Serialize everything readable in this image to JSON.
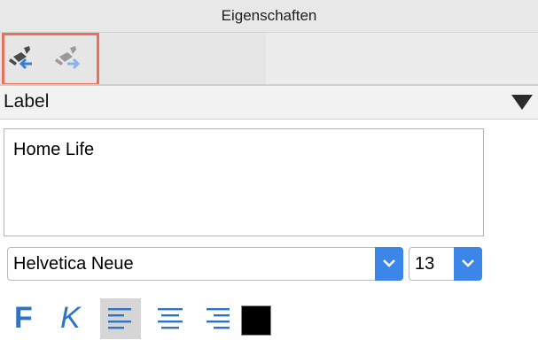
{
  "window": {
    "title": "Eigenschaften"
  },
  "toolbar": {
    "buttons": [
      {
        "name": "paste-style-button",
        "icon": "brush-arrow-left-icon"
      },
      {
        "name": "copy-style-button",
        "icon": "brush-arrow-right-icon"
      }
    ]
  },
  "label_section": {
    "title": "Label",
    "text": "Home Life",
    "font": {
      "family": "Helvetica Neue",
      "size": "13"
    },
    "format": {
      "bold": "F",
      "italic": "K",
      "alignment": "left",
      "color": "#000000"
    }
  },
  "colors": {
    "accent": "#3d86e9",
    "highlight_border": "#e8715b",
    "format_blue": "#2f74c4"
  }
}
